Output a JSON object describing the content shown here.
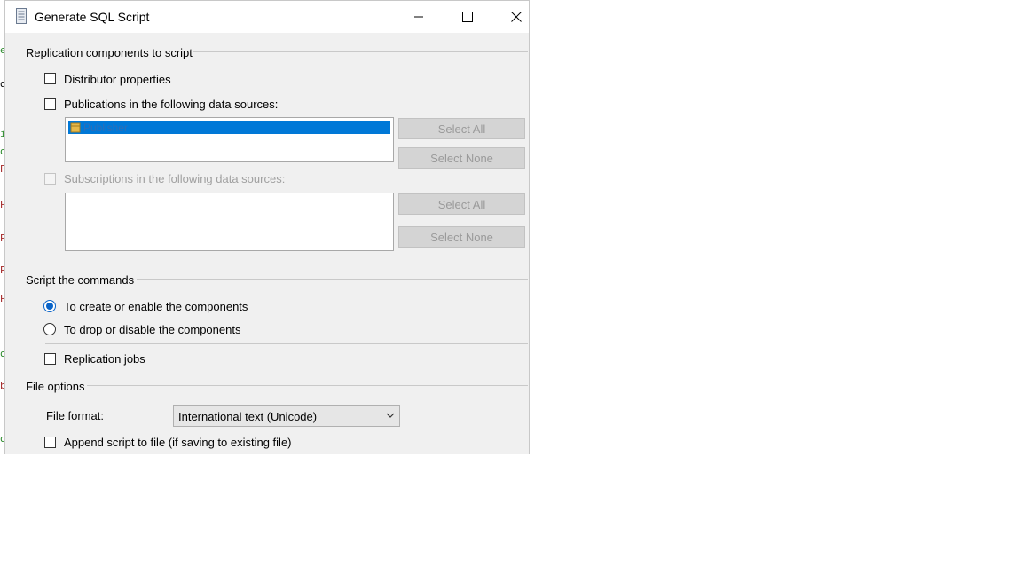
{
  "background_editor": {
    "gutter_letters": [
      "e",
      "d",
      "i",
      "o",
      "P",
      "P",
      "P",
      "P",
      "P",
      "o",
      "b",
      "o"
    ]
  },
  "window": {
    "title": "Generate SQL Script",
    "icons": {
      "app": "database-script-icon",
      "minimize": "minimize-icon",
      "maximize": "maximize-icon",
      "close": "close-icon"
    }
  },
  "replication": {
    "section_title": "Replication components to script",
    "distributor_label": "Distributor properties",
    "distributor_checked": false,
    "publications_label": "Publications in the following data sources:",
    "publications_checked": false,
    "publications_list": [
      "Publisher"
    ],
    "pub_select_all": "Select All",
    "pub_select_none": "Select None",
    "subscriptions_label": "Subscriptions in the following data sources:",
    "subscriptions_enabled": false,
    "sub_select_all": "Select All",
    "sub_select_none": "Select None"
  },
  "commands": {
    "section_title": "Script the commands",
    "create_label": "To create or enable the components",
    "drop_label": "To drop or disable the components",
    "selected": "create",
    "jobs_label": "Replication jobs",
    "jobs_checked": false
  },
  "file_options": {
    "section_title": "File options",
    "format_label": "File format:",
    "format_value": "International text (Unicode)",
    "append_label": "Append script to file (if saving to existing file)",
    "append_checked": false
  },
  "colors": {
    "accent": "#0078d7",
    "dialog_bg": "#f0f0f0",
    "disabled_text": "#a0a0a0"
  }
}
